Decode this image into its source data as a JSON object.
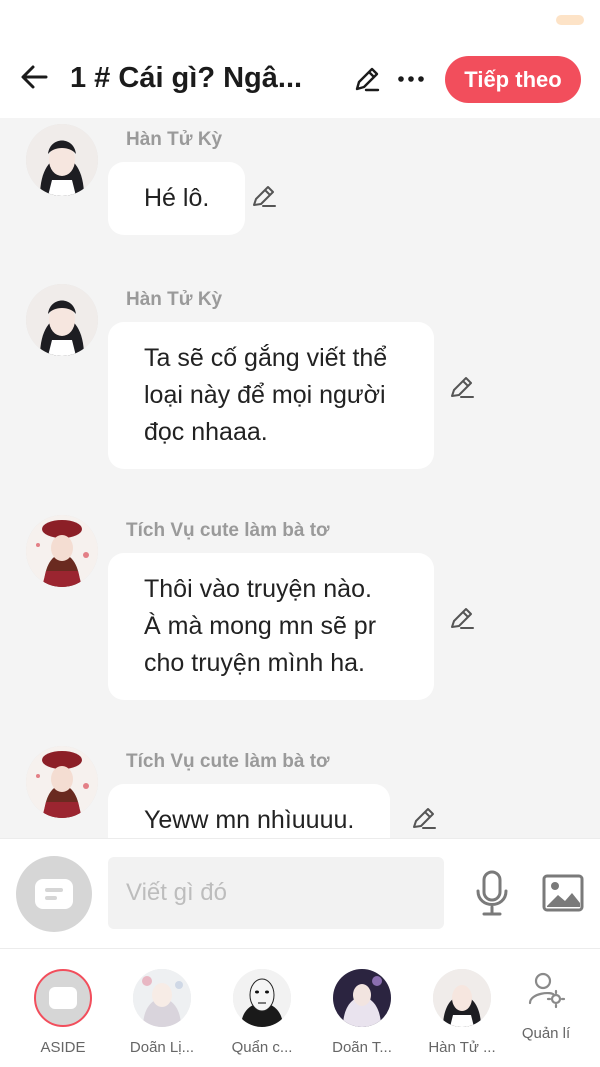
{
  "header": {
    "title": "1 # Cái gì? Ngâ...",
    "next_label": "Tiếp theo"
  },
  "messages": [
    {
      "sender": "Hàn Tử Kỳ",
      "lines": [
        "Hé lô."
      ]
    },
    {
      "sender": "Hàn Tử Kỳ",
      "lines": [
        "Ta sẽ cố gắng viết thể",
        "loại này để mọi người",
        "đọc nhaaa."
      ]
    },
    {
      "sender": "Tích Vụ cute làm bà tơ",
      "lines": [
        "Thôi vào truyện nào.",
        "À mà mong mn sẽ pr",
        "cho truyện mình ha."
      ]
    },
    {
      "sender": "Tích Vụ cute làm bà tơ",
      "lines": [
        "Yeww mn nhìuuuu."
      ]
    }
  ],
  "composer": {
    "placeholder": "Viết gì đó"
  },
  "characters": [
    {
      "name": "ASIDE"
    },
    {
      "name": "Doãn Lị..."
    },
    {
      "name": "Quẩn c..."
    },
    {
      "name": "Doãn T..."
    },
    {
      "name": "Hàn Tử ..."
    }
  ],
  "manage_label": "Quản lí",
  "colors": {
    "accent": "#f24e5c",
    "background": "#f4f4f4",
    "bubble": "#ffffff",
    "sender_text": "#9a9a9a"
  },
  "icons": [
    "back-arrow-icon",
    "pencil-icon",
    "more-dots-icon",
    "microphone-icon",
    "image-icon",
    "user-settings-icon"
  ]
}
